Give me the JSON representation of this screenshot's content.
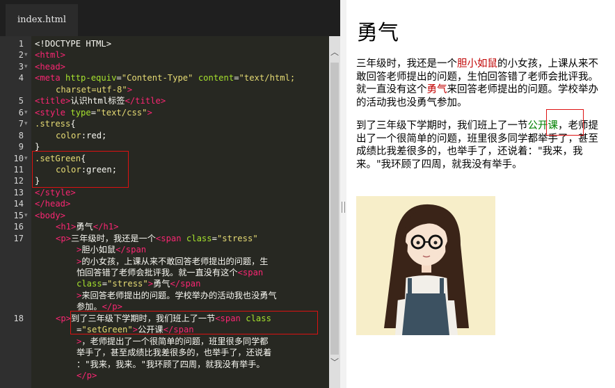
{
  "editor": {
    "tab_label": "index.html",
    "lines": [
      {
        "n": "1",
        "fold": "",
        "segments": [
          {
            "c": "doc",
            "t": "<!DOCTYPE HTML>"
          }
        ]
      },
      {
        "n": "2",
        "fold": "▾",
        "segments": [
          {
            "c": "tag",
            "t": "<html>"
          }
        ]
      },
      {
        "n": "3",
        "fold": "▾",
        "segments": [
          {
            "c": "tag",
            "t": "<head>"
          }
        ]
      },
      {
        "n": "4",
        "fold": "",
        "segments": [
          {
            "c": "tag",
            "t": "<meta "
          },
          {
            "c": "attr",
            "t": "http-equiv"
          },
          {
            "c": "txt",
            "t": "="
          },
          {
            "c": "str",
            "t": "\"Content-Type\""
          },
          {
            "c": "txt",
            "t": " "
          },
          {
            "c": "attr",
            "t": "content"
          },
          {
            "c": "txt",
            "t": "="
          },
          {
            "c": "str",
            "t": "\"text/html;"
          }
        ]
      },
      {
        "n": "",
        "fold": "",
        "indent": true,
        "segments": [
          {
            "c": "str",
            "t": "charset=utf-8\""
          },
          {
            "c": "tag",
            "t": ">"
          }
        ]
      },
      {
        "n": "5",
        "fold": "",
        "segments": [
          {
            "c": "tag",
            "t": "<title>"
          },
          {
            "c": "txt",
            "t": "认识html标签"
          },
          {
            "c": "tag",
            "t": "</title>"
          }
        ]
      },
      {
        "n": "6",
        "fold": "▾",
        "segments": [
          {
            "c": "tag",
            "t": "<style "
          },
          {
            "c": "attr",
            "t": "type"
          },
          {
            "c": "txt",
            "t": "="
          },
          {
            "c": "str",
            "t": "\"text/css\""
          },
          {
            "c": "tag",
            "t": ">"
          }
        ]
      },
      {
        "n": "7",
        "fold": "▾",
        "segments": [
          {
            "c": "sel",
            "t": ".stress"
          },
          {
            "c": "txt",
            "t": "{"
          }
        ]
      },
      {
        "n": "8",
        "fold": "",
        "indent": true,
        "segments": [
          {
            "c": "prop",
            "t": "color"
          },
          {
            "c": "txt",
            "t": ":red;"
          }
        ]
      },
      {
        "n": "9",
        "fold": "",
        "segments": [
          {
            "c": "txt",
            "t": "}"
          }
        ]
      },
      {
        "n": "10",
        "fold": "▾",
        "segments": [
          {
            "c": "sel",
            "t": ".setGreen"
          },
          {
            "c": "txt",
            "t": "{"
          }
        ]
      },
      {
        "n": "11",
        "fold": "",
        "indent": true,
        "segments": [
          {
            "c": "prop",
            "t": "color"
          },
          {
            "c": "txt",
            "t": ":green;"
          }
        ]
      },
      {
        "n": "12",
        "fold": "",
        "segments": [
          {
            "c": "txt",
            "t": "}"
          }
        ]
      },
      {
        "n": "13",
        "fold": "",
        "segments": [
          {
            "c": "tag",
            "t": "</style>"
          }
        ]
      },
      {
        "n": "14",
        "fold": "",
        "segments": [
          {
            "c": "tag",
            "t": "</head>"
          }
        ]
      },
      {
        "n": "15",
        "fold": "▾",
        "segments": [
          {
            "c": "tag",
            "t": "<body>"
          }
        ]
      },
      {
        "n": "16",
        "fold": "",
        "indent": true,
        "segments": [
          {
            "c": "tag",
            "t": "<h1>"
          },
          {
            "c": "txt",
            "t": "勇气"
          },
          {
            "c": "tag",
            "t": "</h1>"
          }
        ]
      },
      {
        "n": "17",
        "fold": "",
        "indent": true,
        "segments": [
          {
            "c": "tag",
            "t": "<p>"
          },
          {
            "c": "txt",
            "t": "三年级时，我还是一个"
          },
          {
            "c": "tag",
            "t": "<span "
          },
          {
            "c": "attr",
            "t": "class"
          },
          {
            "c": "txt",
            "t": "="
          },
          {
            "c": "str",
            "t": "\"stress\""
          }
        ]
      },
      {
        "n": "",
        "fold": "",
        "indent2": true,
        "segments": [
          {
            "c": "tag",
            "t": ">"
          },
          {
            "c": "txt",
            "t": "胆小如鼠"
          },
          {
            "c": "tag",
            "t": "</span"
          }
        ]
      },
      {
        "n": "",
        "fold": "",
        "indent2": true,
        "segments": [
          {
            "c": "tag",
            "t": ">"
          },
          {
            "c": "txt",
            "t": "的小女孩，上课从来不敢回答老师提出的问题，生"
          }
        ]
      },
      {
        "n": "",
        "fold": "",
        "indent2": true,
        "segments": [
          {
            "c": "txt",
            "t": "怕回答错了老师会批评我。就一直没有这个"
          },
          {
            "c": "tag",
            "t": "<span"
          }
        ]
      },
      {
        "n": "",
        "fold": "",
        "indent2": true,
        "segments": [
          {
            "c": "attr",
            "t": "class"
          },
          {
            "c": "txt",
            "t": "="
          },
          {
            "c": "str",
            "t": "\"stress\""
          },
          {
            "c": "tag",
            "t": ">"
          },
          {
            "c": "txt",
            "t": "勇气"
          },
          {
            "c": "tag",
            "t": "</span"
          }
        ]
      },
      {
        "n": "",
        "fold": "",
        "indent2": true,
        "segments": [
          {
            "c": "tag",
            "t": ">"
          },
          {
            "c": "txt",
            "t": "来回答老师提出的问题。学校举办的活动我也没勇气"
          }
        ]
      },
      {
        "n": "",
        "fold": "",
        "indent2": true,
        "segments": [
          {
            "c": "txt",
            "t": "参加。"
          },
          {
            "c": "tag",
            "t": "</p>"
          }
        ]
      },
      {
        "n": "18",
        "fold": "",
        "indent": true,
        "segments": [
          {
            "c": "tag",
            "t": "<p>"
          },
          {
            "c": "txt",
            "t": "到了三年级下学期时，我们班上了一节"
          },
          {
            "c": "tag",
            "t": "<span "
          },
          {
            "c": "attr",
            "t": "class"
          }
        ]
      },
      {
        "n": "",
        "fold": "",
        "indent2": true,
        "segments": [
          {
            "c": "txt",
            "t": "="
          },
          {
            "c": "str",
            "t": "\"setGreen\""
          },
          {
            "c": "tag",
            "t": ">"
          },
          {
            "c": "txt",
            "t": "公开课"
          },
          {
            "c": "tag",
            "t": "</span"
          }
        ]
      },
      {
        "n": "",
        "fold": "",
        "indent2": true,
        "segments": [
          {
            "c": "tag",
            "t": ">"
          },
          {
            "c": "txt",
            "t": "，老师提出了一个很简单的问题，班里很多同学都"
          }
        ]
      },
      {
        "n": "",
        "fold": "",
        "indent2": true,
        "segments": [
          {
            "c": "txt",
            "t": "举手了，甚至成绩比我差很多的，也举手了，还说着"
          }
        ]
      },
      {
        "n": "",
        "fold": "",
        "indent2": true,
        "segments": [
          {
            "c": "txt",
            "t": "：\"我来，我来。\"我环顾了四周，就我没有举手。"
          }
        ]
      },
      {
        "n": "",
        "fold": "",
        "indent2": true,
        "segments": [
          {
            "c": "tag",
            "t": "</p>"
          }
        ]
      }
    ]
  },
  "preview": {
    "title": "勇气",
    "p1": {
      "before": "三年级时，我还是一个",
      "stress1": "胆小如鼠",
      "middle": "的小女孩，上课从来不敢回答老师提出的问题，生怕回答错了老师会批评我。就一直没有这个",
      "stress2": "勇气",
      "after": "来回答老师提出的问题。学校举办的活动我也没勇气参加。"
    },
    "p2": {
      "before": "到了三年级下学期时，我们班上了一节",
      "green": "公开课",
      "after": "，老师提出了一个很简单的问题，班里很多同学都举手了，甚至成绩比我差很多的，也举手了，还说着：\"我来，我来。\"我环顾了四周，就我没有举手。"
    },
    "image": "illustration of girl with glasses and long hair"
  },
  "colors": {
    "stress": "#c00000",
    "green": "#008000",
    "highlight_box": "#dd1111"
  }
}
